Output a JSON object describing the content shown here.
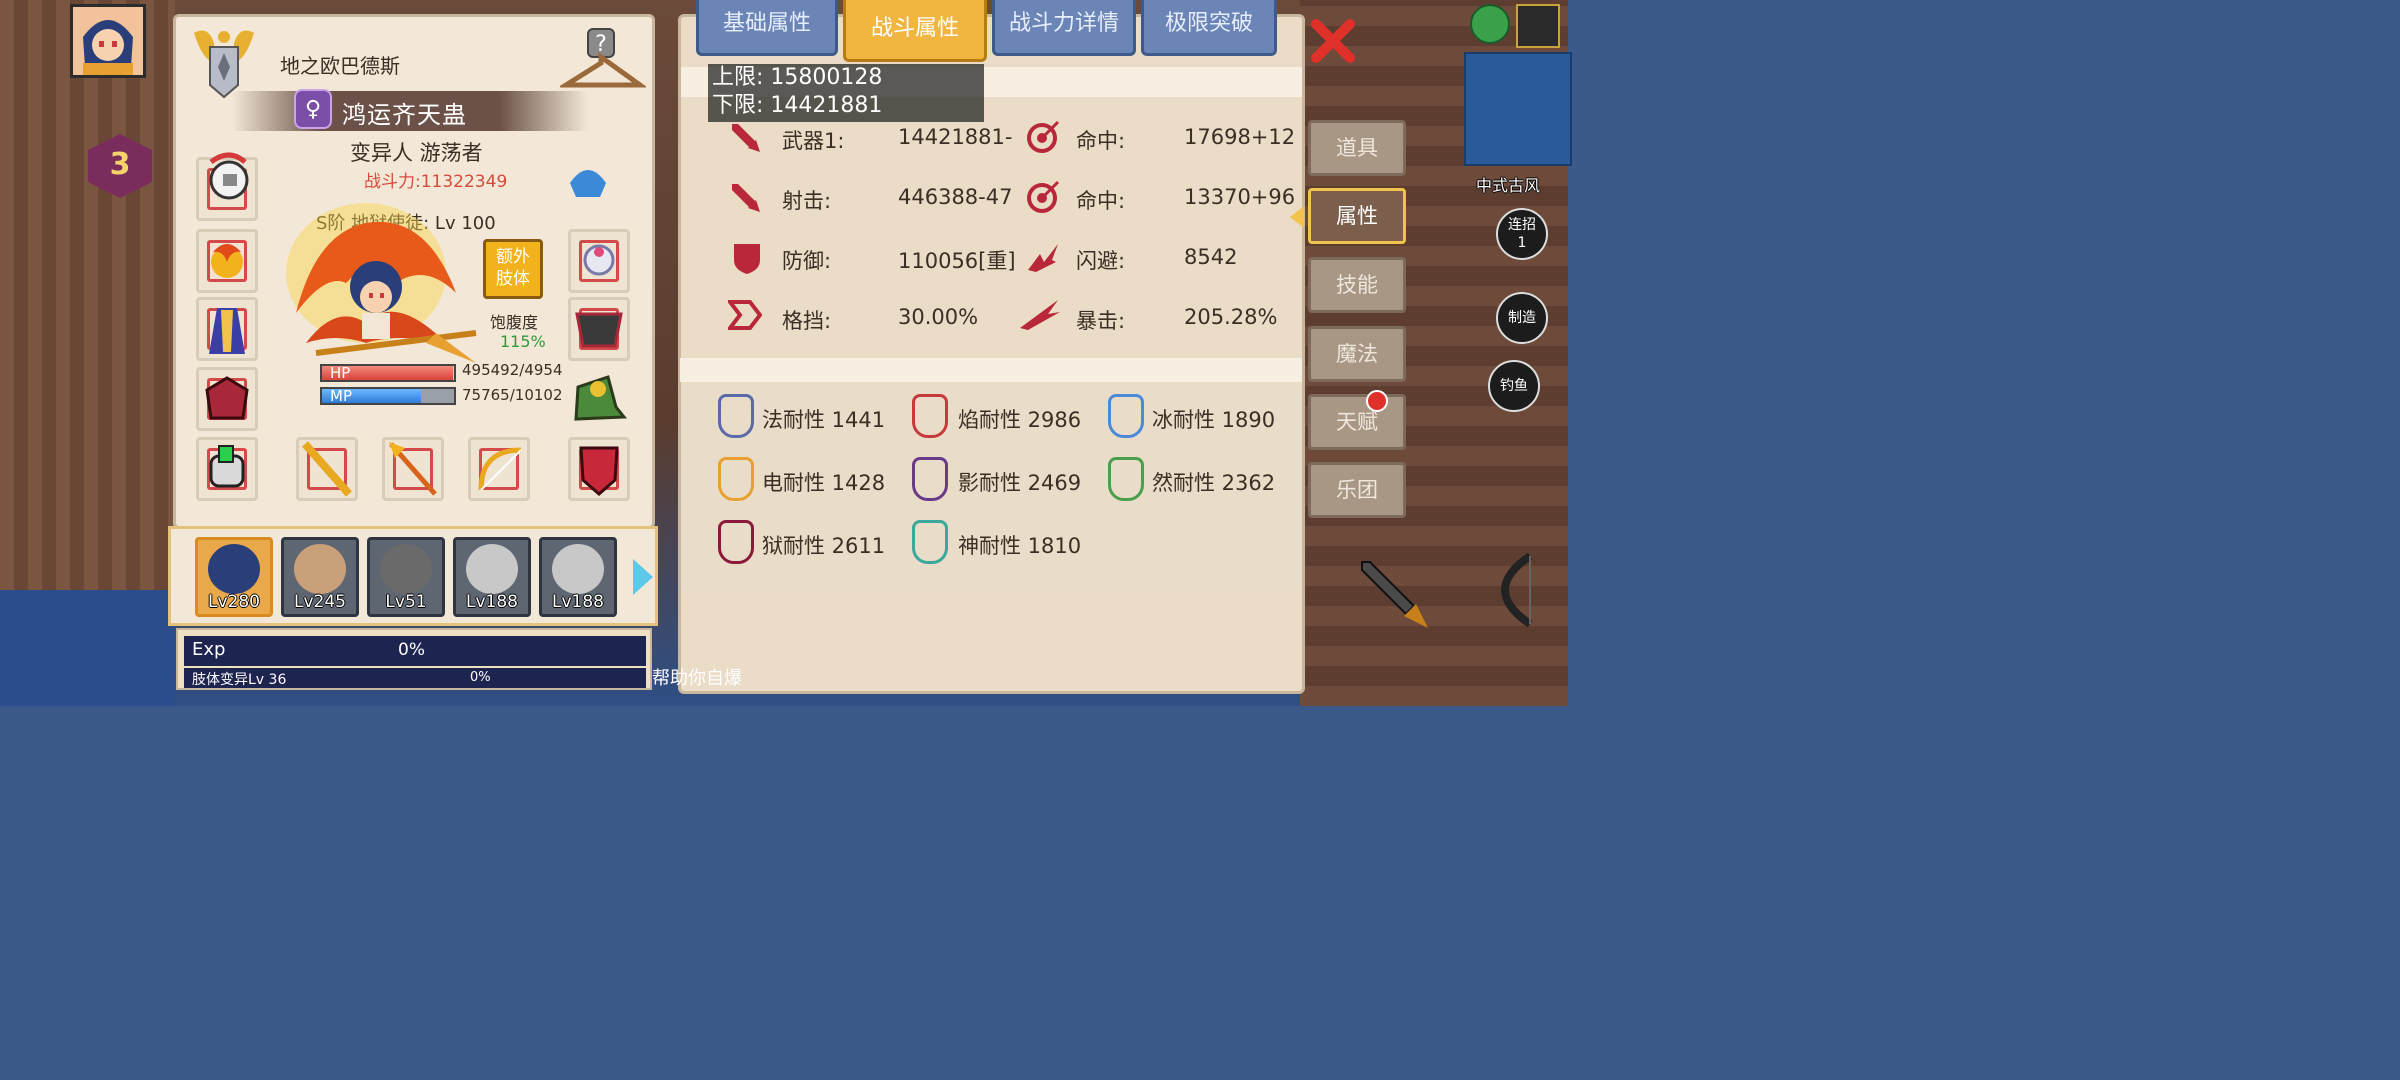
{
  "character": {
    "name": "地之欧巴德斯",
    "title": "鸿运齐天蛊",
    "race_class": "变异人 游荡者",
    "power": "战斗力:11322349",
    "rank_line": "S阶 地狱使徒: Lv 100",
    "extra_limb": [
      "额外",
      "肢体"
    ],
    "satiety_label": "饱腹度",
    "satiety_value": "115%",
    "hp_label": "HP",
    "hp_value": "495492/4954",
    "hp_fraction": 0.99,
    "mp_label": "MP",
    "mp_value": "75765/10102",
    "mp_fraction": 0.75,
    "level_badge": "3"
  },
  "party": [
    {
      "level": "Lv280",
      "selected": true
    },
    {
      "level": "Lv245",
      "selected": false
    },
    {
      "level": "Lv51",
      "selected": false
    },
    {
      "level": "Lv188",
      "selected": false
    },
    {
      "level": "Lv188",
      "selected": false
    }
  ],
  "exp": {
    "label": "Exp",
    "value": "0%",
    "limb_label": "肢体变异Lv 36",
    "limb_value": "0%"
  },
  "tabs": [
    {
      "label": "基础属性",
      "active": false
    },
    {
      "label": "战斗属性",
      "active": true
    },
    {
      "label": "战斗力详情",
      "active": false
    },
    {
      "label": "极限突破",
      "active": false
    }
  ],
  "tooltip": {
    "upper": "上限: 15800128",
    "lower": "下限: 14421881"
  },
  "stats": {
    "weapon1_label": "武器1:",
    "weapon1_value": "14421881-",
    "hit1_label": "命中:",
    "hit1_value": "17698+12",
    "shoot_label": "射击:",
    "shoot_value": "446388-47",
    "hit2_label": "命中:",
    "hit2_value": "13370+96",
    "defense_label": "防御:",
    "defense_value": "110056[重]",
    "dodge_label": "闪避:",
    "dodge_value": "8542",
    "block_label": "格挡:",
    "block_value": "30.00%",
    "crit_label": "暴击:",
    "crit_value": "205.28%"
  },
  "resistances": [
    {
      "text": "法耐性 1441",
      "color": "#5a6aa8"
    },
    {
      "text": "焰耐性 2986",
      "color": "#c83a3a"
    },
    {
      "text": "冰耐性 1890",
      "color": "#4a8ad8"
    },
    {
      "text": "电耐性 1428",
      "color": "#e8a030"
    },
    {
      "text": "影耐性 2469",
      "color": "#6a3a8a"
    },
    {
      "text": "然耐性 2362",
      "color": "#4aa04a"
    },
    {
      "text": "狱耐性 2611",
      "color": "#8a1a3a"
    },
    {
      "text": "神耐性 1810",
      "color": "#3aa89a"
    }
  ],
  "side_menu": [
    {
      "label": "道具",
      "active": false
    },
    {
      "label": "属性",
      "active": true
    },
    {
      "label": "技能",
      "active": false
    },
    {
      "label": "魔法",
      "active": false
    },
    {
      "label": "天赋",
      "active": false
    },
    {
      "label": "乐团",
      "active": false
    }
  ],
  "map_label": "中式古风",
  "circle_buttons": {
    "combo": "连招\n1",
    "craft": "制造",
    "fish": "钓鱼"
  },
  "chat": "帮助你自爆",
  "colors": {
    "accent": "#f0b640",
    "tab_blue": "#6b86b6",
    "power_red": "#d64a3a",
    "satiety_green": "#2e9a3a"
  }
}
